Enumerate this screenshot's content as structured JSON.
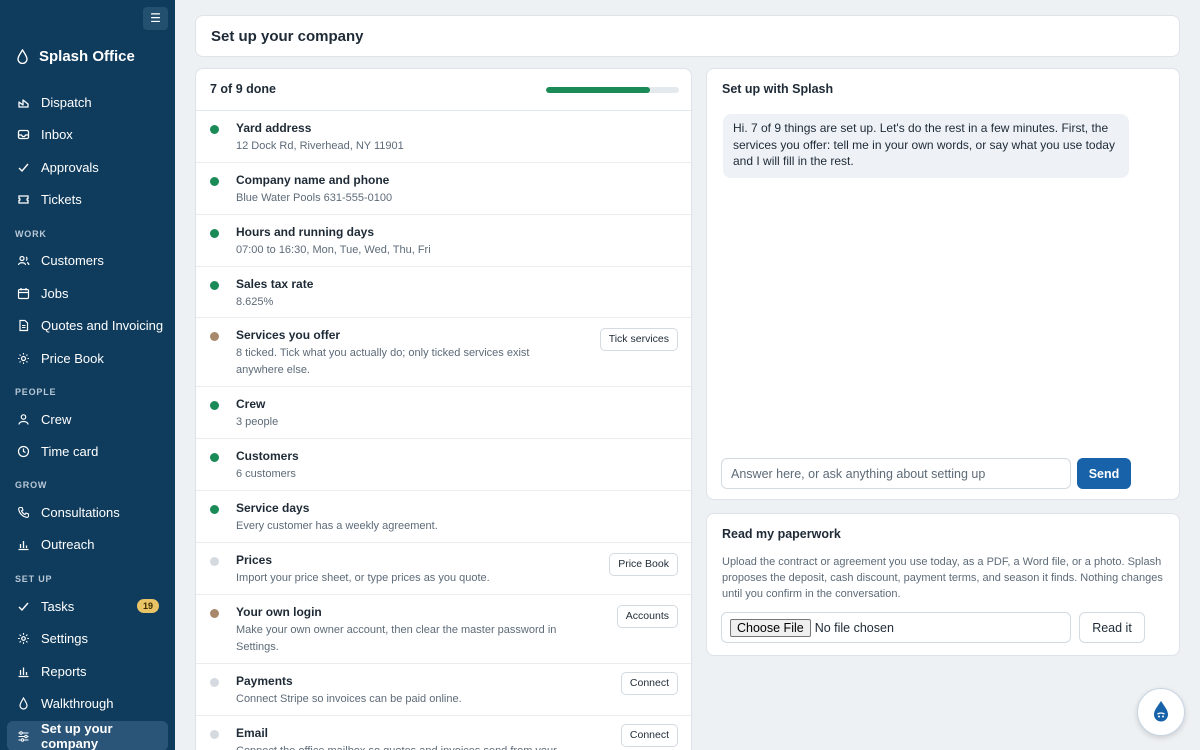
{
  "sidebar": {
    "brand": "Splash Office",
    "menu_icon": "☰",
    "nav": [
      {
        "label": "Dispatch",
        "icon": "dispatch-icon"
      },
      {
        "label": "Inbox",
        "icon": "inbox-icon"
      },
      {
        "label": "Approvals",
        "icon": "check-icon"
      },
      {
        "label": "Tickets",
        "icon": "ticket-icon"
      }
    ],
    "sections": [
      {
        "title": "WORK",
        "items": [
          {
            "label": "Customers",
            "icon": "users-icon"
          },
          {
            "label": "Jobs",
            "icon": "calendar-icon"
          },
          {
            "label": "Quotes and Invoicing",
            "icon": "document-icon"
          },
          {
            "label": "Price Book",
            "icon": "sun-icon"
          }
        ]
      },
      {
        "title": "PEOPLE",
        "items": [
          {
            "label": "Crew",
            "icon": "person-icon"
          },
          {
            "label": "Time card",
            "icon": "clock-icon"
          }
        ]
      },
      {
        "title": "GROW",
        "items": [
          {
            "label": "Consultations",
            "icon": "phone-icon"
          },
          {
            "label": "Outreach",
            "icon": "bar-chart-icon"
          }
        ]
      },
      {
        "title": "SET UP",
        "items": [
          {
            "label": "Tasks",
            "icon": "check-icon",
            "badge": "19"
          },
          {
            "label": "Settings",
            "icon": "gear-icon"
          },
          {
            "label": "Reports",
            "icon": "bar-chart-icon"
          },
          {
            "label": "Walkthrough",
            "icon": "drop-icon"
          },
          {
            "label": "Set up your company",
            "icon": "sliders-icon",
            "active": true
          }
        ]
      }
    ]
  },
  "header": {
    "title": "Set up your company"
  },
  "checklist": {
    "done_label": "7 of 9 done",
    "progress": 0.78,
    "colors": {
      "done": "#1a8a57",
      "partial": "#a8886a",
      "todo": "#d4dae0"
    },
    "items": [
      {
        "title": "Yard address",
        "detail": "12 Dock Rd, Riverhead, NY 11901",
        "status": "done"
      },
      {
        "title": "Company name and phone",
        "detail": "Blue Water Pools 631-555-0100",
        "status": "done"
      },
      {
        "title": "Hours and running days",
        "detail": "07:00 to 16:30, Mon, Tue, Wed, Thu, Fri",
        "status": "done"
      },
      {
        "title": "Sales tax rate",
        "detail": "8.625%",
        "status": "done"
      },
      {
        "title": "Services you offer",
        "detail": "8 ticked. Tick what you actually do; only ticked services exist anywhere else.",
        "status": "partial",
        "action": "Tick services"
      },
      {
        "title": "Crew",
        "detail": "3 people",
        "status": "done"
      },
      {
        "title": "Customers",
        "detail": "6 customers",
        "status": "done"
      },
      {
        "title": "Service days",
        "detail": "Every customer has a weekly agreement.",
        "status": "done"
      },
      {
        "title": "Prices",
        "detail": "Import your price sheet, or type prices as you quote.",
        "status": "todo",
        "action": "Price Book"
      },
      {
        "title": "Your own login",
        "detail": "Make your own owner account, then clear the master password in Settings.",
        "status": "partial",
        "action": "Accounts"
      },
      {
        "title": "Payments",
        "detail": "Connect Stripe so invoices can be paid online.",
        "status": "todo",
        "action": "Connect"
      },
      {
        "title": "Email",
        "detail": "Connect the office mailbox so quotes and invoices send from your address.",
        "status": "todo",
        "action": "Connect"
      }
    ]
  },
  "chat": {
    "title": "Set up with Splash",
    "message": "Hi. 7 of 9 things are set up. Let's do the rest in a few minutes. First, the services you offer: tell me in your own words, or say what you use today and I will fill in the rest.",
    "input_placeholder": "Answer here, or ask anything about setting up",
    "send_label": "Send"
  },
  "paperwork": {
    "title": "Read my paperwork",
    "description": "Upload the contract or agreement you use today, as a PDF, a Word file, or a photo. Splash proposes the deposit, cash discount, payment terms, and season it finds. Nothing changes until you confirm in the conversation.",
    "choose_label": "Choose File",
    "file_status": "No file chosen",
    "read_label": "Read it"
  },
  "help": {
    "icon": "splash-drop-icon"
  }
}
